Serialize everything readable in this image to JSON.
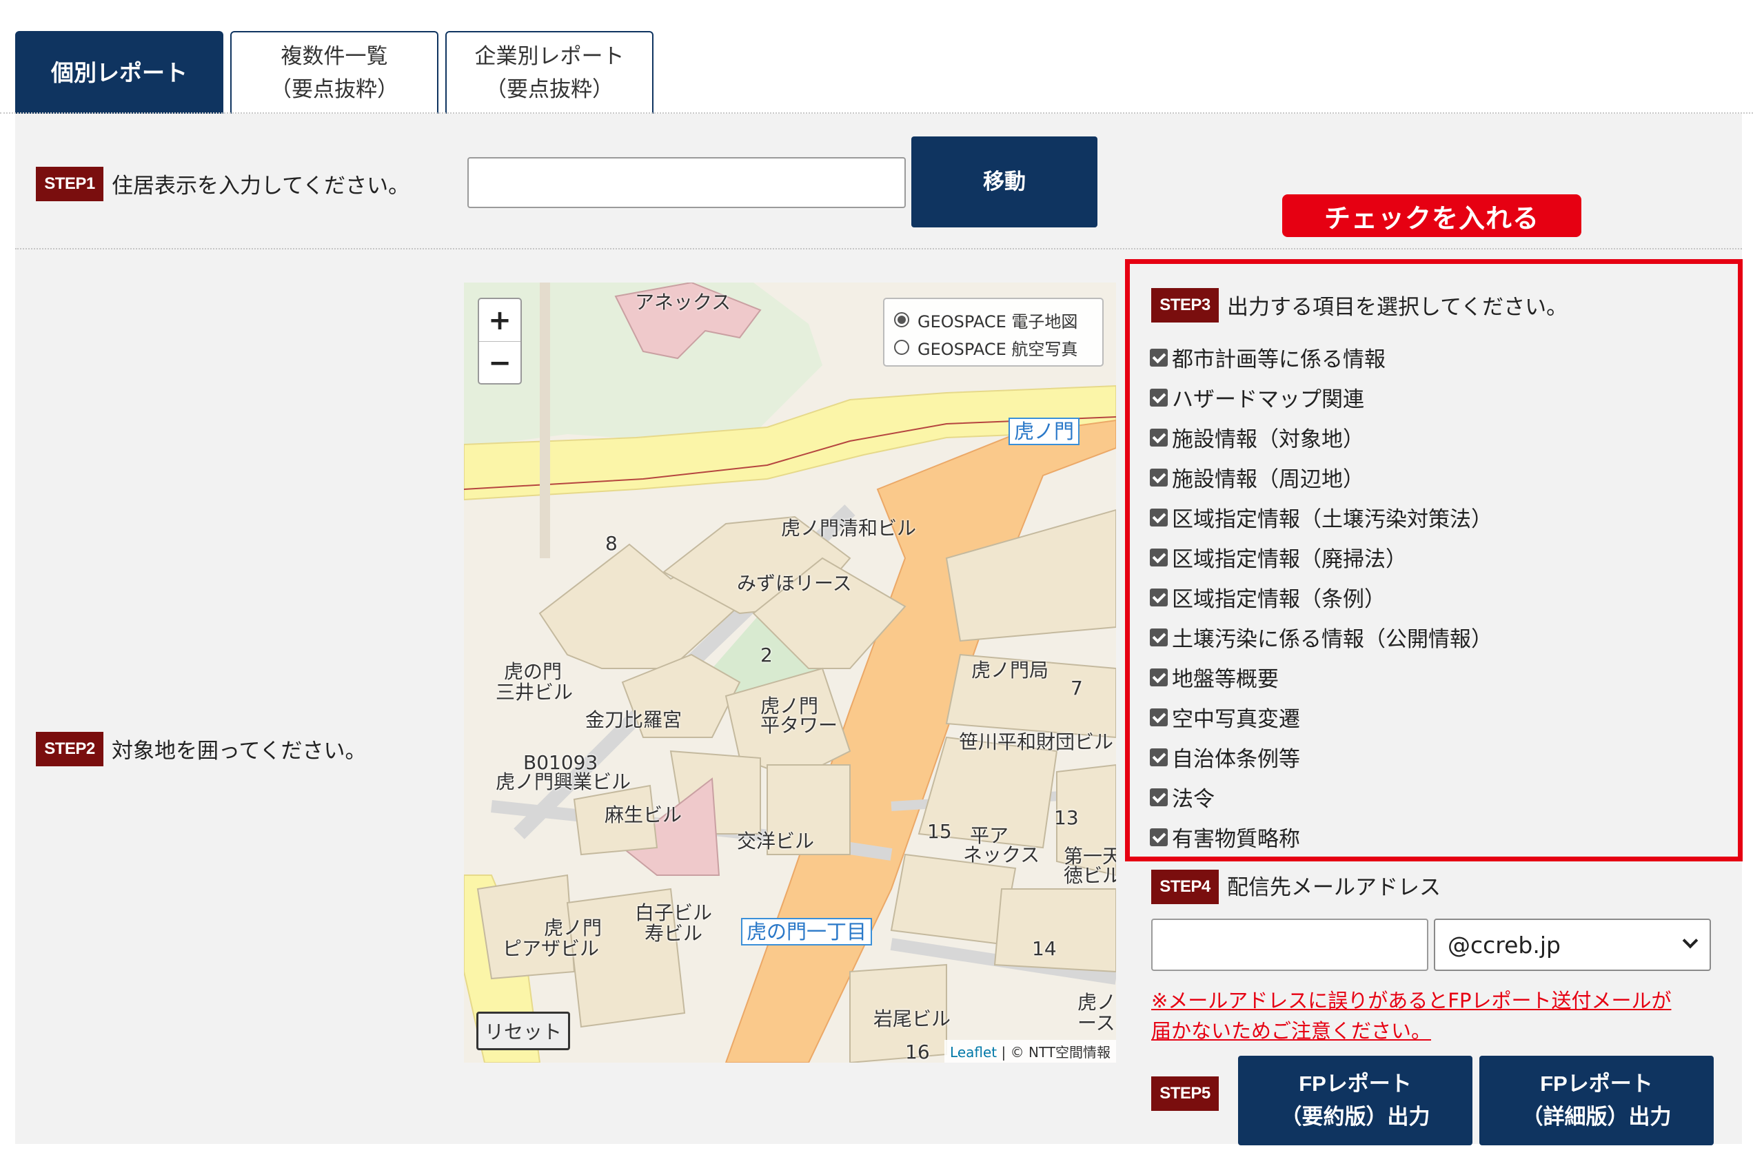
{
  "tabs": [
    {
      "line1": "個別レポート",
      "line2": ""
    },
    {
      "line1": "複数件一覧",
      "line2": "（要点抜粋）"
    },
    {
      "line1": "企業別レポート",
      "line2": "（要点抜粋）"
    }
  ],
  "step1": {
    "badge": "STEP1",
    "text": "住居表示を入力してください。",
    "input_value": "",
    "button": "移動"
  },
  "callout": "チェックを入れる",
  "step2": {
    "badge": "STEP2",
    "text": "対象地を囲ってください。"
  },
  "step3": {
    "badge": "STEP3",
    "text": "出力する項目を選択してください。",
    "items": [
      "都市計画等に係る情報",
      "ハザードマップ関連",
      "施設情報（対象地）",
      "施設情報（周辺地）",
      "区域指定情報（土壌汚染対策法）",
      "区域指定情報（廃掃法）",
      "区域指定情報（条例）",
      "土壌汚染に係る情報（公開情報）",
      "地盤等概要",
      "空中写真変遷",
      "自治体条例等",
      "法令",
      "有害物質略称"
    ]
  },
  "step4": {
    "badge": "STEP4",
    "text": "配信先メールアドレス",
    "email_value": "",
    "domain": "@ccreb.jp",
    "notice_line1": "※メールアドレスに誤りがあるとFPレポート送付メールが",
    "notice_line2": "届かないためご注意ください。"
  },
  "step5": {
    "badge": "STEP5",
    "btn1_line1": "FPレポート",
    "btn1_line2": "（要約版）出力",
    "btn2_line1": "FPレポート",
    "btn2_line2": "（詳細版）出力"
  },
  "map": {
    "zoom_in": "+",
    "zoom_out": "−",
    "layer1": "GEOSPACE 電子地図",
    "layer2": "GEOSPACE 航空写真",
    "reset": "リセット",
    "attrib_leaflet": "Leaflet",
    "attrib_rest": " | © NTT空間情報",
    "labels": {
      "annex": "アネックス",
      "toranomon_st": "虎ノ門",
      "seiwa": "虎ノ門清和ビル",
      "mizuho": "みずほリース",
      "n8": "8",
      "n2": "2",
      "mitsui1": "虎の門",
      "mitsui2": "三井ビル",
      "kotohira": "金刀比羅宮",
      "hiratower1": "虎ノ門",
      "hiratower2": "平タワー",
      "post": "虎ノ門局",
      "n7": "7",
      "sasakawa": "笹川平和財団ビル",
      "b01093": "B01093",
      "kogyo": "虎ノ門興業ビル",
      "aso": "麻生ビル",
      "koyo": "交洋ビル",
      "n15": "15",
      "annex2a": "平ア",
      "annex2b": "ネックス",
      "n13": "13",
      "daiichi1": "第一天",
      "daiichi2": "徳ビル",
      "shiroko1": "白子ビル",
      "shiroko2": "寿ビル",
      "piaza1": "虎ノ門",
      "piaza2": "ピアザビル",
      "itchome": "虎の門一丁目",
      "n14": "14",
      "iwao": "岩尾ビル",
      "n16": "16",
      "tora3a": "虎ノ",
      "tora3b": "ースト"
    }
  }
}
